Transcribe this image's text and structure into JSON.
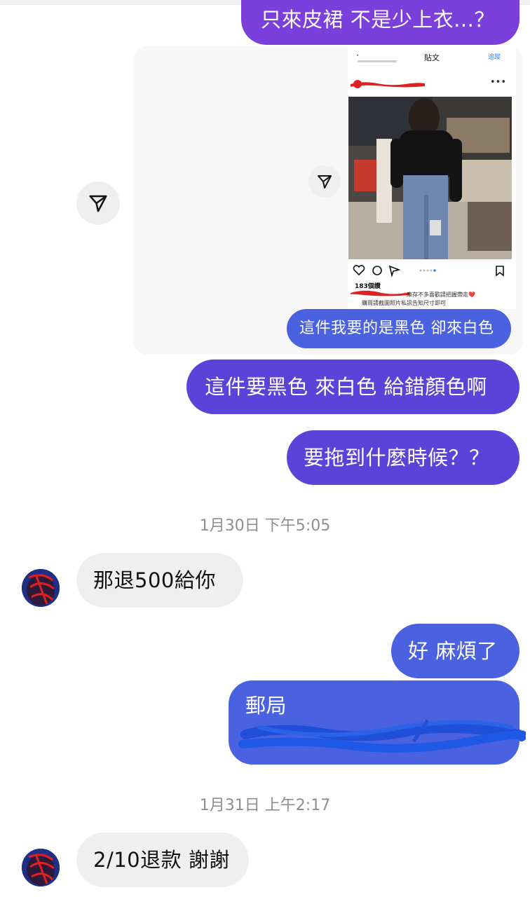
{
  "messages": {
    "m1": "只來皮裙 不是少上衣...？",
    "m2": "這件我要的是黑色 卻來白色",
    "m3": "這件要黑色 來白色 給錯顏色啊",
    "m4": "要拖到什麼時候？？",
    "m5": "那退500給你",
    "m6": "好 麻煩了",
    "m7": "郵局",
    "m8": "2/10退款 謝謝"
  },
  "timestamps": {
    "t1": "1月30日 下午5:05",
    "t2": "1月31日 上午2:17"
  },
  "shared_post": {
    "header_title": "貼文",
    "header_link": "追蹤",
    "likes": "183個讚",
    "caption_line1": "庫存不多喜歡請把握帶走❤️",
    "caption_line2": "購買請截圖照片私訊告知尺寸即可"
  },
  "colors": {
    "outgoing_purple": "#7b3fdc",
    "outgoing_indigo": "#5b43d9",
    "outgoing_blue": "#4a61e0",
    "incoming_gray": "#efefef",
    "redaction_red": "#e02020",
    "redaction_blue": "#1f4fd8"
  },
  "icons": [
    "share-icon",
    "heart-icon",
    "comment-icon",
    "bookmark-icon",
    "more-icon"
  ]
}
